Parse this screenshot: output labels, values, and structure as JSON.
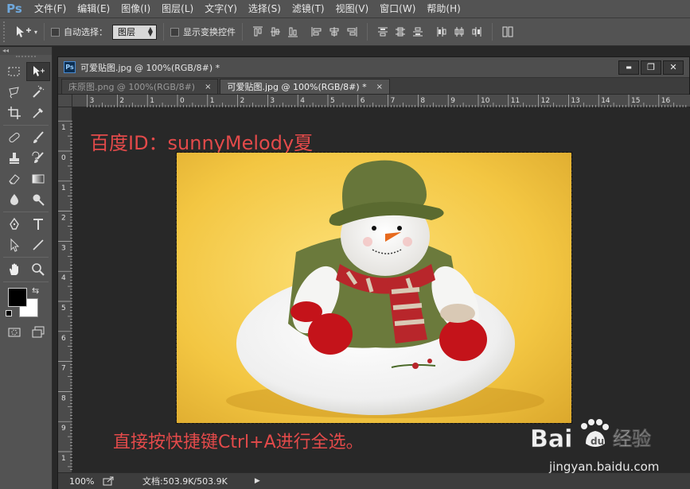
{
  "app": {
    "logo": "Ps",
    "menu": [
      "文件(F)",
      "编辑(E)",
      "图像(I)",
      "图层(L)",
      "文字(Y)",
      "选择(S)",
      "滤镜(T)",
      "视图(V)",
      "窗口(W)",
      "帮助(H)"
    ]
  },
  "options": {
    "auto_select_label": "自动选择：",
    "auto_select_target": "图层",
    "show_transform_label": "显示变换控件"
  },
  "document": {
    "title": "可爱贴图.jpg @ 100%(RGB/8#) *",
    "tabs": [
      {
        "label": "床原图.png @ 100%(RGB/8#)",
        "close": "×"
      },
      {
        "label": "可爱贴图.jpg @ 100%(RGB/8#) *",
        "close": "×"
      }
    ],
    "window_buttons": {
      "minimize": "▬",
      "restore": "❐",
      "close": "✕"
    },
    "ruler_h_labels": [
      "3",
      "2",
      "1",
      "0",
      "1",
      "2",
      "3",
      "4",
      "5",
      "6",
      "7",
      "8",
      "9",
      "10",
      "11",
      "12",
      "13",
      "14",
      "15",
      "16"
    ],
    "ruler_v_labels": [
      "1",
      "0",
      "1",
      "2",
      "3",
      "4",
      "5",
      "6",
      "7",
      "8",
      "9",
      "1"
    ]
  },
  "canvas": {
    "watermark_top": "百度ID：sunnyMelody夏",
    "watermark_bottom": "直接按快捷键Ctrl+A进行全选。"
  },
  "status": {
    "zoom": "100%",
    "doc_size": "文档:503.9K/503.9K",
    "play": "▶"
  },
  "baidu": {
    "logo_text": "Bai du 经验",
    "url": "jingyan.baidu.com"
  },
  "colors": {
    "watermark_red": "#e34a4a",
    "ps_blue": "#6fa8dc",
    "photo_yellow": "#f4c842"
  }
}
